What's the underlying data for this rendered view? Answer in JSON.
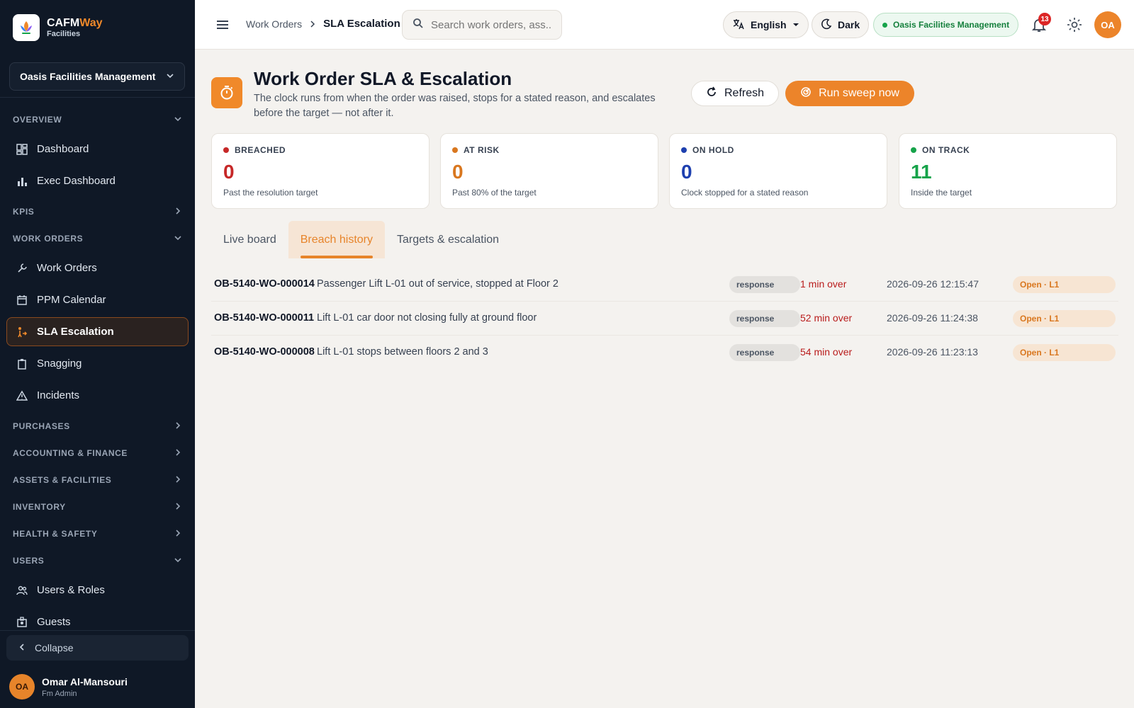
{
  "brand": {
    "name_main": "CAFM",
    "name_accent": "Way",
    "sub": "Facilities"
  },
  "sidebar": {
    "org": "Oasis Facilities Management",
    "sections": [
      {
        "label": "OVERVIEW",
        "expanded": true,
        "items": [
          {
            "label": "Dashboard",
            "icon": "dashboard-icon"
          },
          {
            "label": "Exec Dashboard",
            "icon": "bar-chart-icon"
          }
        ]
      },
      {
        "label": "KPIS",
        "expanded": false,
        "items": []
      },
      {
        "label": "WORK ORDERS",
        "expanded": true,
        "items": [
          {
            "label": "Work Orders",
            "icon": "wrench-icon"
          },
          {
            "label": "PPM Calendar",
            "icon": "calendar-icon"
          },
          {
            "label": "SLA Escalation",
            "icon": "escalation-icon",
            "active": true
          },
          {
            "label": "Snagging",
            "icon": "clipboard-icon"
          },
          {
            "label": "Incidents",
            "icon": "warning-icon"
          }
        ]
      },
      {
        "label": "PURCHASES",
        "expanded": false,
        "items": []
      },
      {
        "label": "ACCOUNTING & FINANCE",
        "expanded": false,
        "items": []
      },
      {
        "label": "ASSETS & FACILITIES",
        "expanded": false,
        "items": []
      },
      {
        "label": "INVENTORY",
        "expanded": false,
        "items": []
      },
      {
        "label": "HEALTH & SAFETY",
        "expanded": false,
        "items": []
      },
      {
        "label": "USERS",
        "expanded": true,
        "items": [
          {
            "label": "Users & Roles",
            "icon": "users-icon"
          },
          {
            "label": "Guests",
            "icon": "badge-icon"
          }
        ]
      }
    ],
    "collapse_label": "Collapse",
    "user": {
      "initials": "OA",
      "name": "Omar Al-Mansouri",
      "role": "Fm Admin"
    }
  },
  "header": {
    "breadcrumb": [
      "Work Orders",
      "SLA Escalation"
    ],
    "search_placeholder": "Search work orders, ass...",
    "language": "English",
    "theme": "Dark",
    "org_badge": "Oasis Facilities Management",
    "notifications": "13",
    "avatar_initials": "OA"
  },
  "page": {
    "title": "Work Order SLA & Escalation",
    "description": "The clock runs from when the order was raised, stops for a stated reason, and escalates before the target — not after it.",
    "refresh_label": "Refresh",
    "sweep_label": "Run sweep now"
  },
  "stats": [
    {
      "label": "BREACHED",
      "value": "0",
      "sub": "Past the resolution target",
      "color": "#c62828"
    },
    {
      "label": "AT RISK",
      "value": "0",
      "sub": "Past 80% of the target",
      "color": "#d9771f"
    },
    {
      "label": "ON HOLD",
      "value": "0",
      "sub": "Clock stopped for a stated reason",
      "color": "#1e40af"
    },
    {
      "label": "ON TRACK",
      "value": "11",
      "sub": "Inside the target",
      "color": "#16a34a"
    }
  ],
  "tabs": [
    {
      "label": "Live board",
      "active": false
    },
    {
      "label": "Breach history",
      "active": true
    },
    {
      "label": "Targets & escalation",
      "active": false
    }
  ],
  "breaches": [
    {
      "code": "OB-5140-WO-000014",
      "description": "Passenger Lift L-01 out of service, stopped at Floor 2",
      "type": "response",
      "over": "1 min over",
      "timestamp": "2026-09-26 12:15:47",
      "status": "Open · L1"
    },
    {
      "code": "OB-5140-WO-000011",
      "description": "Lift L-01 car door not closing fully at ground floor",
      "type": "response",
      "over": "52 min over",
      "timestamp": "2026-09-26 11:24:38",
      "status": "Open · L1"
    },
    {
      "code": "OB-5140-WO-000008",
      "description": "Lift L-01 stops between floors 2 and 3",
      "type": "response",
      "over": "54 min over",
      "timestamp": "2026-09-26 11:23:13",
      "status": "Open · L1"
    }
  ]
}
